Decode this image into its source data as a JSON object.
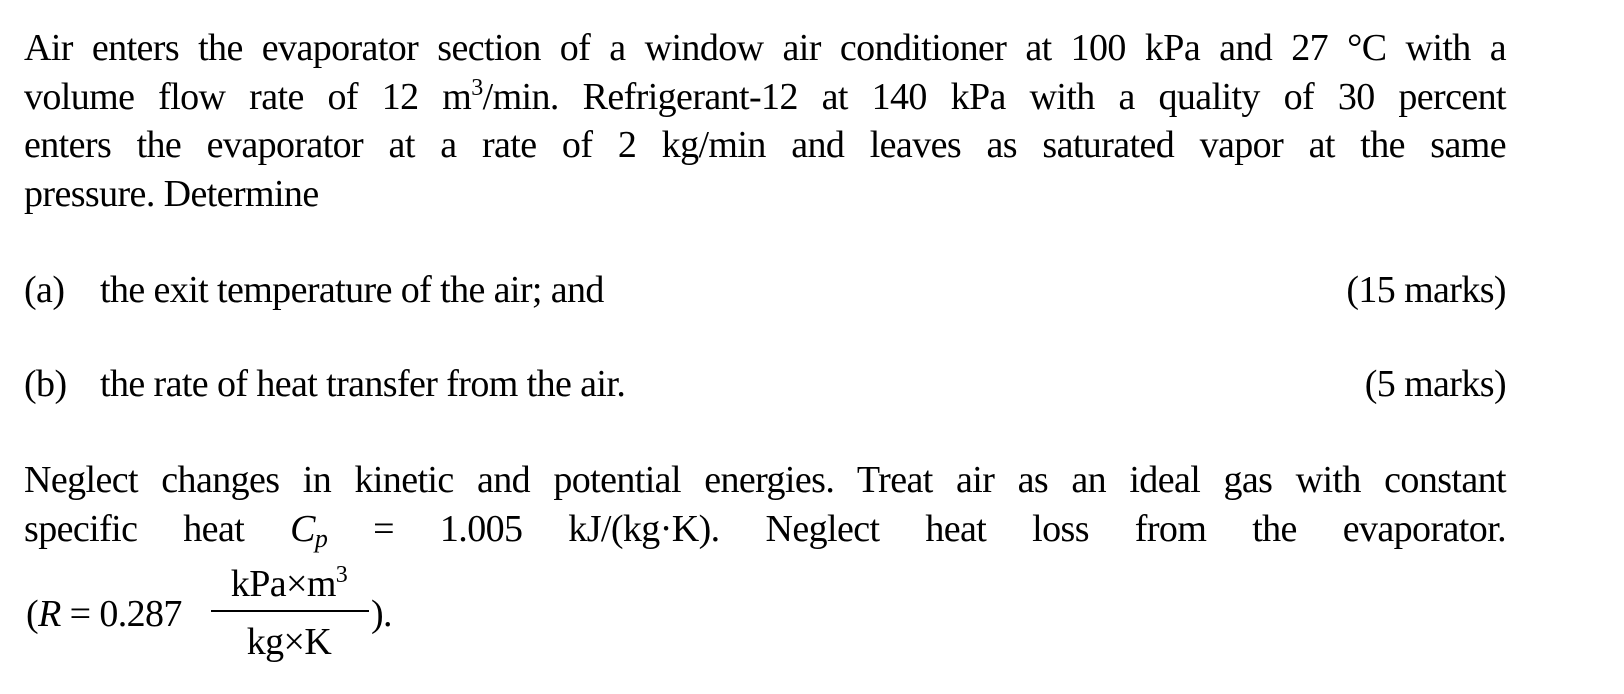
{
  "problem": {
    "intro_lines": [
      "Air enters the evaporator section of a window air conditioner at 100 kPa and 27 °C with a",
      {
        "before": "volume flow rate of 12 m",
        "sup": "3",
        "after": "/min.  Refrigerant-12 at 140 kPa with a quality of 30 percent"
      },
      "enters the evaporator at a rate of 2 kg/min and leaves as saturated vapor at the same",
      "pressure.  Determine"
    ],
    "parts": [
      {
        "label": "(a)",
        "text": "the exit temperature of the air; and",
        "marks": "(15 marks)"
      },
      {
        "label": "(b)",
        "text": "the rate of heat transfer from the air.",
        "marks": "(5 marks)"
      }
    ],
    "assumptions_line1": "Neglect changes in kinetic and potential energies.  Treat air as an ideal gas with constant",
    "assumptions_line2": {
      "before": "specific heat ",
      "symbol": "C",
      "subscript": "p",
      "after": " = 1.005 kJ/(kg·K).    Neglect heat loss from the evaporator."
    },
    "gas_constant": {
      "open": "(",
      "symbol": "R",
      "equals_value": " = 0.287",
      "numerator": "kPa×m",
      "numerator_sup": "3",
      "denominator": "kg×K",
      "close": ")."
    }
  }
}
